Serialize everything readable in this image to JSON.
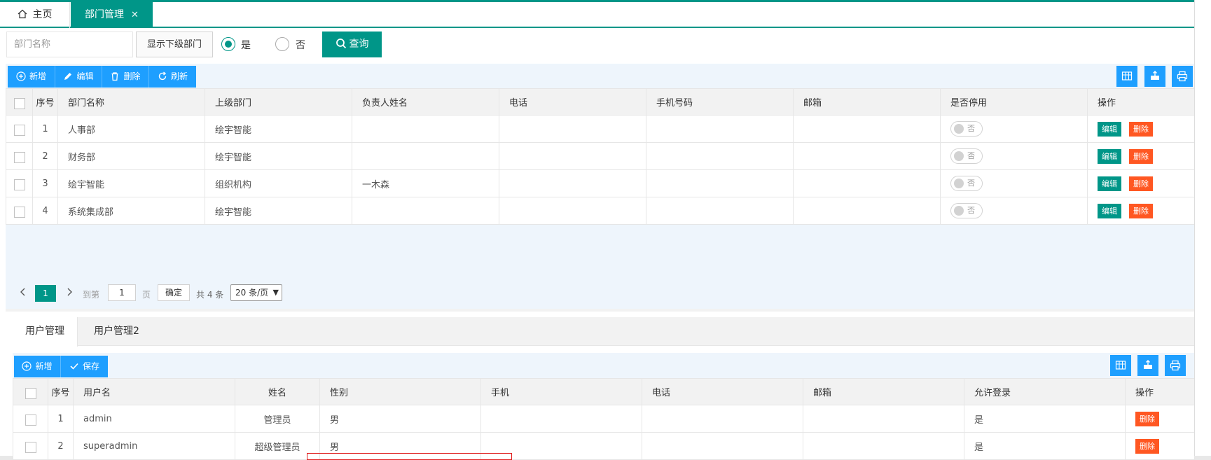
{
  "tabs": {
    "home": "主页",
    "dept": "部门管理",
    "close": "✕"
  },
  "search": {
    "placeholder": "部门名称",
    "show_sub_label": "显示下级部门",
    "radio_yes": "是",
    "radio_no": "否",
    "selected": "是",
    "query_label": "查询"
  },
  "toolbar": {
    "add": "新增",
    "edit": "编辑",
    "delete": "删除",
    "refresh": "刷新"
  },
  "dept_table": {
    "headers": [
      "序号",
      "部门名称",
      "上级部门",
      "负责人姓名",
      "电话",
      "手机号码",
      "邮箱",
      "是否停用",
      "操作"
    ],
    "rows": [
      {
        "no": "1",
        "name": "人事部",
        "parent": "绘宇智能",
        "leader": "",
        "phone": "",
        "mobile": "",
        "email": "",
        "disabled": "否"
      },
      {
        "no": "2",
        "name": "财务部",
        "parent": "绘宇智能",
        "leader": "",
        "phone": "",
        "mobile": "",
        "email": "",
        "disabled": "否"
      },
      {
        "no": "3",
        "name": "绘宇智能",
        "parent": "组织机构",
        "leader": "一木森",
        "phone": "",
        "mobile": "",
        "email": "",
        "disabled": "否"
      },
      {
        "no": "4",
        "name": "系统集成部",
        "parent": "绘宇智能",
        "leader": "",
        "phone": "",
        "mobile": "",
        "email": "",
        "disabled": "否"
      }
    ],
    "edit_label": "编辑",
    "delete_label": "删除"
  },
  "pager": {
    "current": "1",
    "goto_label": "到第",
    "page_input": "1",
    "page_unit": "页",
    "confirm": "确定",
    "total": "共 4 条",
    "page_size": "20 条/页"
  },
  "sub_tabs": [
    "用户管理",
    "用户管理2"
  ],
  "user_toolbar": {
    "add": "新增",
    "save": "保存"
  },
  "user_table": {
    "headers": [
      "序号",
      "用户名",
      "姓名",
      "性别",
      "手机",
      "电话",
      "邮箱",
      "允许登录",
      "操作"
    ],
    "rows": [
      {
        "no": "1",
        "username": "admin",
        "name": "管理员",
        "gender": "男",
        "mobile": "",
        "phone": "",
        "email": "",
        "allow_login": "是"
      },
      {
        "no": "2",
        "username": "superadmin",
        "name": "超级管理员",
        "gender": "男",
        "mobile": "",
        "phone": "",
        "email": "",
        "allow_login": "是"
      }
    ],
    "delete_label": "删除"
  },
  "colors": {
    "primary": "#009688",
    "blue": "#1e9fff",
    "danger": "#ff5722"
  }
}
